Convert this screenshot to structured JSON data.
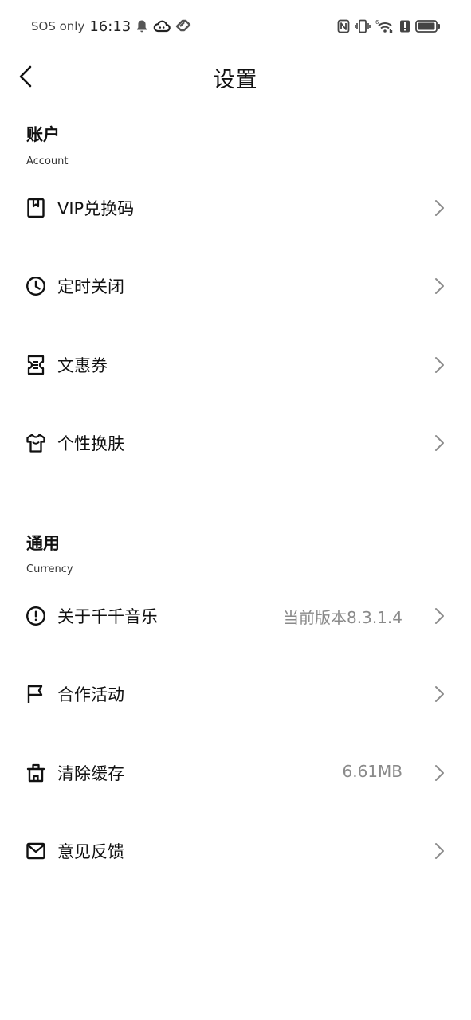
{
  "status_bar": {
    "sos": "SOS only",
    "time": "16:13",
    "icons_left": [
      "bell-icon",
      "cloud-icon",
      "heart-tag-icon"
    ],
    "icons_right": [
      "nfc-icon",
      "vibrate-icon",
      "wifi-icon",
      "alert-icon",
      "battery-icon"
    ],
    "wifi_badge": "6"
  },
  "header": {
    "title": "设置",
    "back_icon": "chevron-left-icon"
  },
  "sections": [
    {
      "title": "账户",
      "subtitle": "Account",
      "items": [
        {
          "label": "VIP兑换码",
          "value": "",
          "icon": "bookmark-icon"
        },
        {
          "label": "定时关闭",
          "value": "",
          "icon": "clock-icon"
        },
        {
          "label": "文惠券",
          "value": "",
          "icon": "ticket-icon"
        },
        {
          "label": "个性换肤",
          "value": "",
          "icon": "shirt-icon"
        }
      ]
    },
    {
      "title": "通用",
      "subtitle": "Currency",
      "items": [
        {
          "label": "关于千千音乐",
          "value": "当前版本8.3.1.4",
          "icon": "info-icon"
        },
        {
          "label": "合作活动",
          "value": "",
          "icon": "flag-icon"
        },
        {
          "label": "清除缓存",
          "value": "6.61MB",
          "icon": "trash-icon"
        },
        {
          "label": "意见反馈",
          "value": "",
          "icon": "mail-icon"
        }
      ]
    }
  ],
  "colors": {
    "text": "#111111",
    "secondary_text": "#8a8a8a",
    "chevron": "#8c8c8c",
    "background": "#ffffff"
  }
}
